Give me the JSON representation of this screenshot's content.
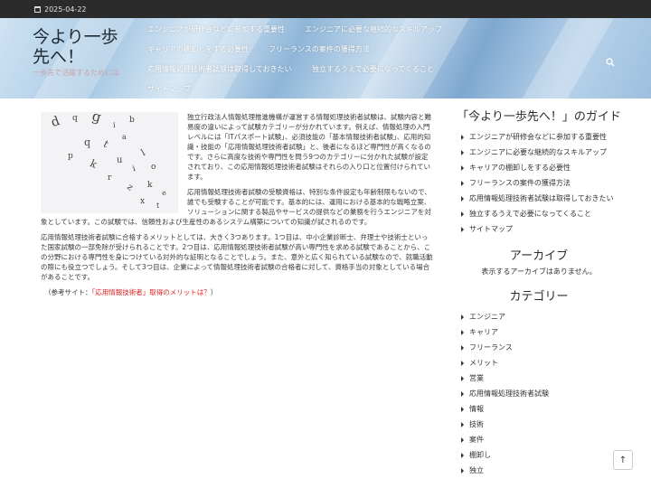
{
  "topbar": {
    "date": "2025-04-22",
    "icon": "calendar-icon"
  },
  "header": {
    "site_title": "今より一歩先へ！",
    "tagline": "一歩先で活躍するためには",
    "nav": [
      "エンジニアが研修会などに参加する重要性",
      "エンジニアに必要な継続的なスキルアップ",
      "キャリアの棚卸しをする必要性",
      "フリーランスの案件の獲得方法",
      "応用情報処理技術者試験は取得しておきたい",
      "独立するうえで必要になってくること",
      "サイトマップ"
    ],
    "search_icon": "search-icon"
  },
  "article": {
    "paragraphs": [
      "独立行政法人情報処理推進機構が運営する情報処理技術者試験は、試験内容と難易度の違いによって試験カテゴリーが分かれています。例えば、情報処理の入門レベルには「ITパスポート試験」、必須技能の「基本情報技術者試験」、応用的知識・技能の「応用情報処理技術者試験」と、後者になるほど専門性が高くなるのです。さらに高度な技術や専門性を問う9つのカテゴリーに分かれた試験が設定されており、この応用情報処理技術者試験はそれらの入り口と位置付けられています。",
      "応用情報処理技術者試験の受験資格は、特別な条件設定も年齢制限もないので、誰でも受験することが可能です。基本的には、運用における基本的な戦略立案、ソリューションに関する製品やサービスの提供などの業務を行うエンジニアを対象としています。この試験では、信頼性および生産性のあるシステム構築についての知識が試されるのです。",
      "応用情報処理技術者試験に合格するメリットとしては、大きく3つあります。1つ目は、中小企業診断士、弁理士や技術士といった国家試験の一部免除が受けられることです。2つ目は、応用情報処理技術者試験が高い専門性を求める試験であることから、この分野における専門性を身につけている対外的な証明となることでしょう。また、意外と広く知られている試験なので、就職活動の際にも役立つでしょう。そして3つ目は、企業によって情報処理技術者試験の合格者に対して、資格手当の対象としている場合があることです。"
    ],
    "ref_prefix": "（参考サイト：",
    "ref_link": "「応用情報技術者」取得のメリットは？",
    "ref_suffix": "）"
  },
  "sidebar": {
    "guide_title": "「今より一歩先へ！」のガイド",
    "guide_items": [
      "エンジニアが研修会などに参加する重要性",
      "エンジニアに必要な継続的なスキルアップ",
      "キャリアの棚卸しをする必要性",
      "フリーランスの案件の獲得方法",
      "応用情報処理技術者試験は取得しておきたい",
      "独立するうえで必要になってくること",
      "サイトマップ"
    ],
    "archive_title": "アーカイブ",
    "archive_empty": "表示するアーカイブはありません。",
    "category_title": "カテゴリー",
    "categories": [
      "エンジニア",
      "キャリア",
      "フリーランス",
      "メリット",
      "営業",
      "応用情報処理技術者試験",
      "情報",
      "技術",
      "案件",
      "棚卸し",
      "独立"
    ]
  },
  "totop_icon": "arrow-up-icon"
}
